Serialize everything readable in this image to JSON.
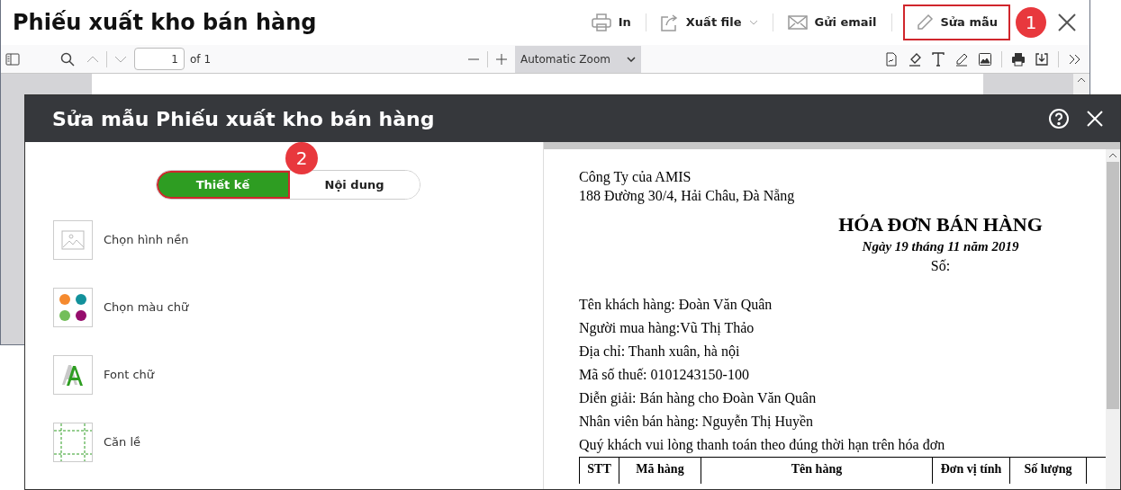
{
  "window": {
    "title": "Phiếu xuất kho bán hàng",
    "callout": "1",
    "actions": [
      {
        "kind": "print",
        "label": "In",
        "dropdown": false,
        "highlighted": false
      },
      {
        "kind": "export",
        "label": "Xuất file",
        "dropdown": true,
        "highlighted": false
      },
      {
        "kind": "email",
        "label": "Gửi email",
        "dropdown": false,
        "highlighted": false
      },
      {
        "kind": "edit",
        "label": "Sửa mẫu",
        "dropdown": false,
        "highlighted": true
      }
    ]
  },
  "viewer_toolbar": {
    "page": "1",
    "page_count": "of 1",
    "zoom": "Automatic Zoom"
  },
  "dialog": {
    "title": "Sửa mẫu Phiếu xuất kho bán hàng",
    "callout": "2",
    "tabs": [
      {
        "label": "Thiết kế",
        "selected": true,
        "highlighted": true
      },
      {
        "label": "Nội dung",
        "selected": false,
        "highlighted": false
      }
    ],
    "options": [
      {
        "kind": "background",
        "label": "Chọn hình nền"
      },
      {
        "kind": "color",
        "label": "Chọn màu chữ"
      },
      {
        "kind": "font",
        "label": "Font chữ"
      },
      {
        "kind": "margin",
        "label": "Căn lề"
      }
    ],
    "preview": {
      "company": [
        "Công Ty của AMIS",
        "188 Đường 30/4, Hải Châu, Đà Nẵng"
      ],
      "title": "HÓA ĐƠN BÁN HÀNG",
      "date": "Ngày 19 tháng 11 năm 2019",
      "number": "Số:",
      "info": [
        "Tên khách hàng: Đoàn Văn Quân",
        "Người mua hàng:Vũ Thị Thảo",
        "Địa chỉ: Thanh xuân, hà nội",
        "Mã số thuế: 0101243150-100",
        "Diễn giải: Bán hàng cho Đoàn Văn Quân",
        "Nhân viên bán hàng: Nguyễn Thị Huyền",
        "Quý khách vui lòng thanh toán theo đúng thời hạn trên hóa đơn"
      ],
      "table_columns": [
        "STT",
        "Mã hàng",
        "Tên hàng",
        "Đơn vị tính",
        "Số lượng"
      ]
    }
  }
}
